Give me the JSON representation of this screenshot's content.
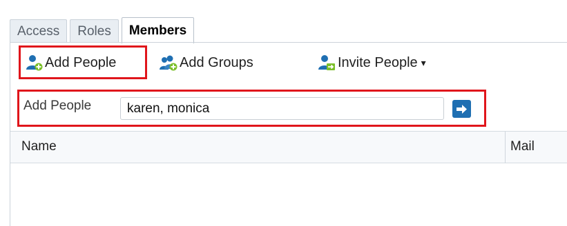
{
  "tabs": [
    {
      "label": "Access"
    },
    {
      "label": "Roles"
    },
    {
      "label": "Members",
      "active": true
    }
  ],
  "toolbar": {
    "add_people": {
      "label": "Add People",
      "icon": "add-person-icon"
    },
    "add_groups": {
      "label": "Add Groups",
      "icon": "add-group-icon"
    },
    "invite_people": {
      "label": "Invite People",
      "icon": "invite-person-icon",
      "dropdown": "▾"
    }
  },
  "add_people_row": {
    "label": "Add People",
    "value": "karen, monica",
    "go_icon": "arrow-right-icon"
  },
  "table": {
    "columns": [
      "Name",
      "Mail"
    ],
    "rows": []
  },
  "colors": {
    "highlight": "#e0151b",
    "icon_blue": "#1f6fb2",
    "icon_green": "#7bbf2a"
  }
}
